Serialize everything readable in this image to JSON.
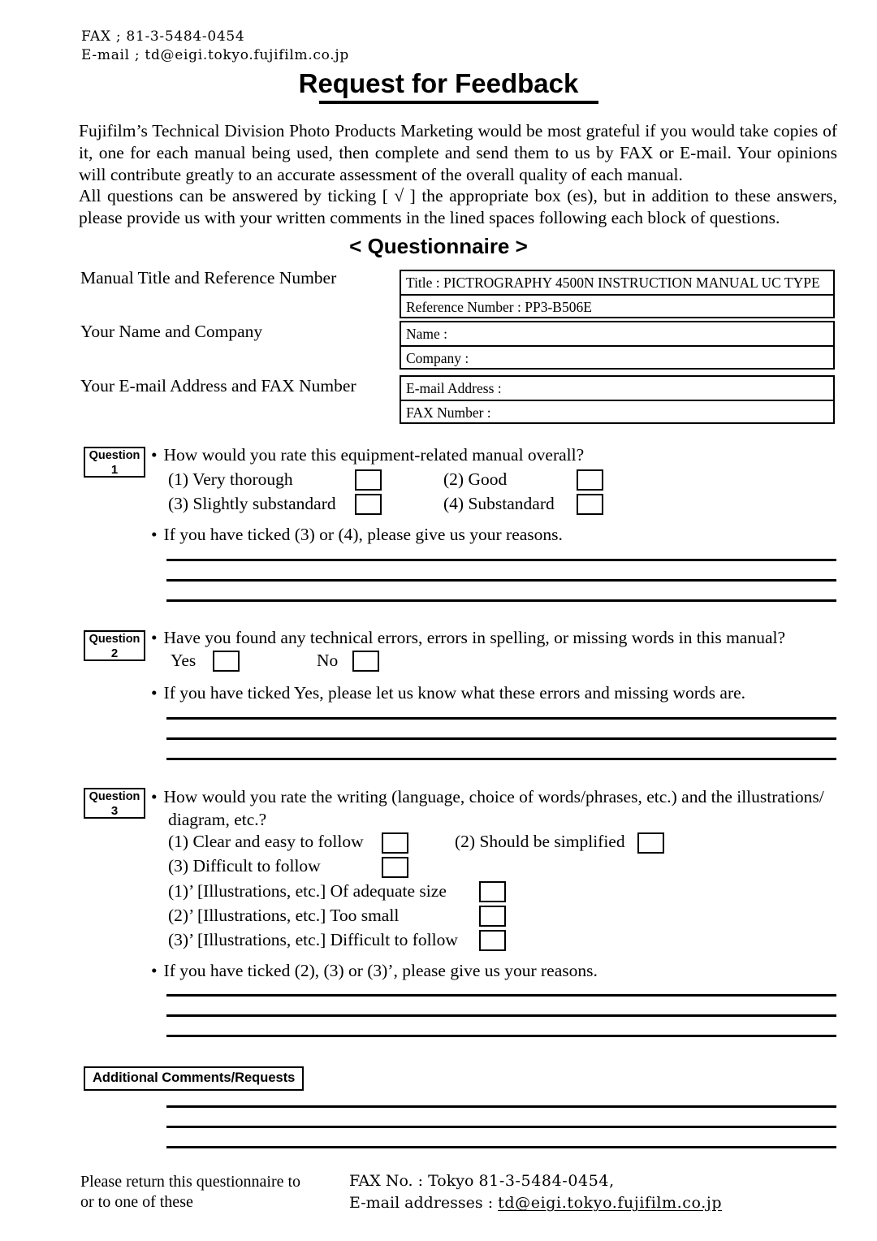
{
  "header": {
    "fax_line": "FAX    ; 81-3-5484-0454",
    "email_line": "E-mail ; td@eigi.tokyo.fujifilm.co.jp"
  },
  "title": "Request for Feedback",
  "intro": {
    "paragraph_1": "Fujifilm’s Technical Division Photo Products Marketing would be most grateful if you would take copies of it, one for each manual being used, then complete and send them to us by FAX or E-mail. Your opinions will contribute greatly to an accurate assessment of the overall quality of each manual.",
    "paragraph_2": "All questions can be answered by ticking [ √ ] the appropriate box (es), but in addition to these answers, please provide us with your written comments in the lined spaces following each block of questions."
  },
  "questionnaire_heading": "< Questionnaire >",
  "info_sections": [
    {
      "label": "Manual Title and Reference Number",
      "rows": [
        "Title : PICTROGRAPHY 4500N INSTRUCTION MANUAL UC TYPE",
        "Reference Number : PP3-B506E"
      ]
    },
    {
      "label": "Your Name and Company",
      "rows": [
        "Name :",
        "Company :"
      ]
    },
    {
      "label": "Your E-mail Address and FAX Number",
      "rows": [
        "E-mail Address :",
        "FAX Number :"
      ]
    }
  ],
  "questions": [
    {
      "tag": "Question",
      "number": "1",
      "prompt": "How would you rate this equipment-related manual overall?",
      "options": [
        "(1) Very thorough",
        "(2) Good",
        "(3) Slightly substandard",
        "(4) Substandard"
      ],
      "followup": "If you have ticked (3) or (4), please give us your reasons."
    },
    {
      "tag": "Question",
      "number": "2",
      "prompt": "Have you found any technical errors, errors in spelling, or missing words in this manual?",
      "options": [
        "Yes",
        "No"
      ],
      "followup": "If you have ticked Yes, please let us know what these errors and missing words are."
    },
    {
      "tag": "Question",
      "number": "3",
      "prompt_line_1": "How would you rate the writing (language, choice of words/phrases, etc.) and the illustrations/",
      "prompt_line_2": "diagram, etc.?",
      "options": [
        "(1)  Clear and easy to follow",
        "(2) Should be simplified",
        "(3)  Difficult to follow",
        "(1)’ [Illustrations, etc.] Of adequate size",
        "(2)’ [Illustrations, etc.] Too small",
        "(3)’ [Illustrations, etc.] Difficult to follow"
      ],
      "followup": "If you have ticked (2), (3) or (3)’, please give us your reasons."
    }
  ],
  "additional_comments_label": "Additional Comments/Requests",
  "footer": {
    "left_line_1": "Please return this questionnaire to",
    "left_line_2": "or to one of these",
    "fax_label": "FAX No.  :  Tokyo",
    "fax_number": "81-3-5484-0454,",
    "email_label": "E-mail addresses  :",
    "email_value": "td@eigi.tokyo.fujifilm.co.jp"
  },
  "bullet_glyph": "•"
}
